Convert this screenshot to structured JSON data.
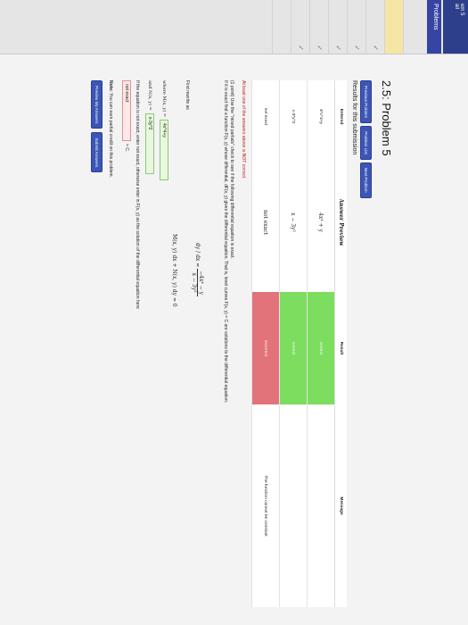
{
  "sidebar": {
    "crumb": "em 5",
    "crumb_sub": "ail",
    "heading": "Problems"
  },
  "page": {
    "title": "2.5: Problem 5",
    "nav": {
      "previous": "Previous Problem",
      "list": "Problem List",
      "next": "Next Problem"
    },
    "results_title": "Results for this submission"
  },
  "results": {
    "headers": [
      "Entered",
      "Answer Preview",
      "Result",
      "Message"
    ],
    "rows": [
      {
        "entered": "4*x^4+y",
        "preview": "4x⁴ + y",
        "result": "correct",
        "message": ""
      },
      {
        "entered": "x-3*y^2",
        "preview": "x − 3y²",
        "result": "correct",
        "message": ""
      },
      {
        "entered": "not exact",
        "preview": "not exact",
        "result": "incorrect",
        "message": "The function cannot be constant"
      }
    ]
  },
  "problem": {
    "warning": "At least one of the answers above is NOT correct.",
    "statement": "(1 point) Use the \"mixed partials\" check to see if the following differential equation is exact.",
    "instructions": "If it is exact find a function F(x, y) whose differential, dF(x, y) gives the differential equation. That is, level curves F(x, y) = C are solutions to the differential equation:",
    "eqn_lhs": "dy / dx =",
    "eqn_num": "−4x⁴ − y",
    "eqn_den": "x − 3y²",
    "first_rewrite": "First rewrite as",
    "eqn2": "M(x, y) dx + N(x, y) dy = 0",
    "m_label": "where M(x, y) =",
    "m_value": "4x^4+y",
    "n_label": "and N(x, y) =",
    "n_value": "x-3y^2",
    "exact_label": "If the equation is not exact, enter not exact, otherwise enter in F(x, y) as the solution of the differential equation here",
    "exact_value": "not exact",
    "eq_c": "= C.",
    "note_bold": "Note:",
    "note_text": "You can earn partial credit on this problem."
  },
  "buttons": {
    "preview": "Preview My Answers",
    "submit": "Submit Answers"
  },
  "colors": {
    "correct": "#7cdd5f",
    "incorrect": "#e2737a",
    "nav_button": "#3b56b6"
  }
}
